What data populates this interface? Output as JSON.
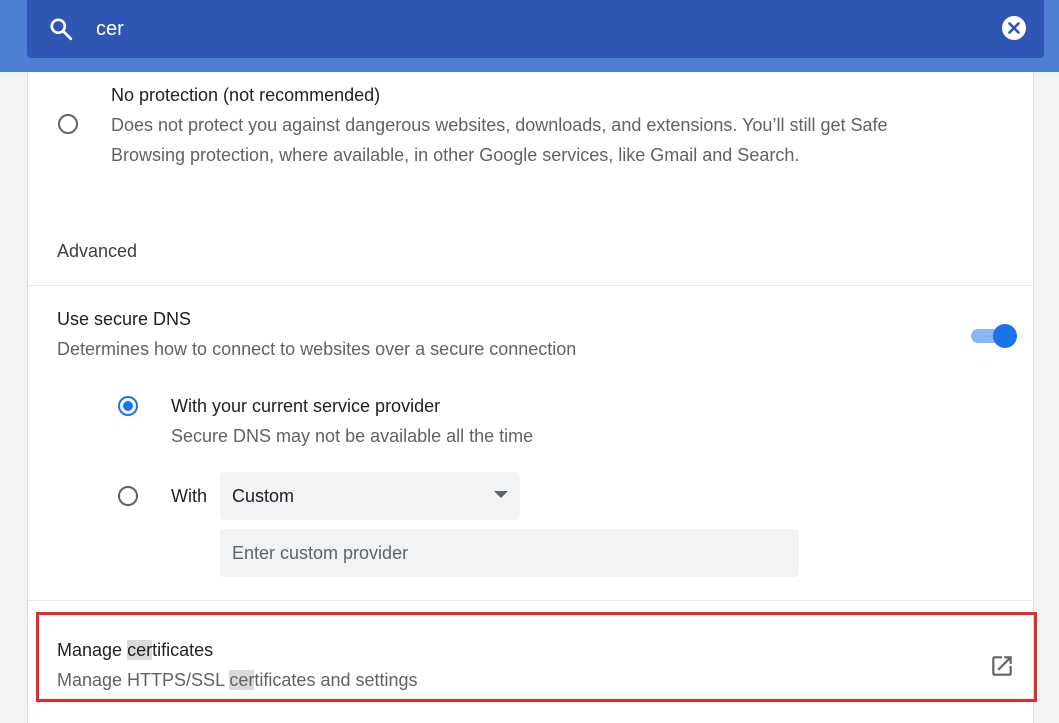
{
  "search": {
    "value": "cer",
    "icon": "search-icon",
    "clear_icon": "close-icon"
  },
  "safe_browsing": {
    "no_protection": {
      "title": "No protection (not recommended)",
      "description_line1": "Does not protect you against dangerous websites, downloads, and extensions. You’ll still get Safe",
      "description_line2": "Browsing protection, where available, in other Google services, like Gmail and Search.",
      "selected": false
    }
  },
  "advanced": {
    "heading": "Advanced",
    "secure_dns": {
      "title": "Use secure DNS",
      "description": "Determines how to connect to websites over a secure connection",
      "enabled": true,
      "option_current": {
        "title": "With your current service provider",
        "description": "Secure DNS may not be available all the time",
        "selected": true
      },
      "option_custom": {
        "label": "With",
        "selected": false,
        "dropdown_value": "Custom",
        "input_placeholder": "Enter custom provider"
      }
    },
    "manage_certificates": {
      "title_prefix": "Manage ",
      "title_match": "cer",
      "title_suffix": "tificates",
      "description_prefix": "Manage HTTPS/SSL ",
      "description_match": "cer",
      "description_suffix": "tificates and settings",
      "icon": "external-link-icon"
    }
  },
  "colors": {
    "header": "#3056b5",
    "accent": "#1a73e8",
    "highlight_border": "#e52b25"
  }
}
